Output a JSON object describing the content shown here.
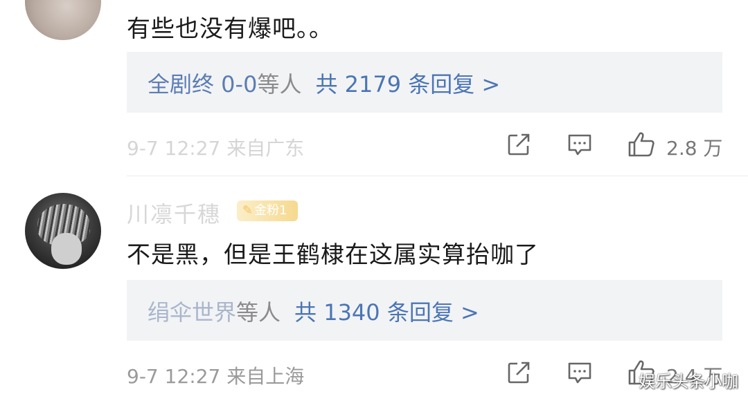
{
  "comments": [
    {
      "text": "有些也没有爆吧。。",
      "replies": {
        "users": "全剧终 0-0",
        "suffix": "等人",
        "count": "共 2179 条回复 >"
      },
      "meta": "9-7 12:27  来自广东",
      "likes": "2.8 万"
    },
    {
      "username": "川凛千穗",
      "badge": "金粉1",
      "text": "不是黑，但是王鹤棣在这属实算抬咖了",
      "replies": {
        "users": "绢伞世界",
        "suffix": "等人",
        "count": "共 1340 条回复 >"
      },
      "meta": "9-7 12:27  来自上海",
      "likes": "2.4 万"
    }
  ],
  "watermark": "娱乐头条小咖",
  "icons": [
    "share-icon",
    "comment-icon",
    "like-icon",
    "tag-icon"
  ]
}
